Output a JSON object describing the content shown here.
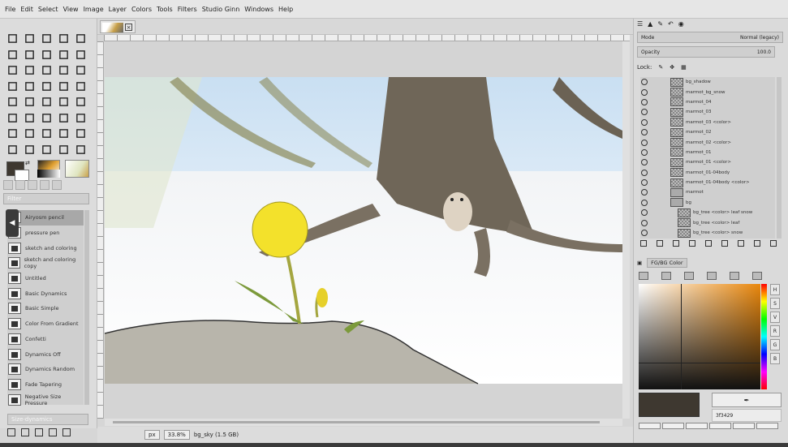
{
  "menu": [
    "File",
    "Edit",
    "Select",
    "View",
    "Image",
    "Layer",
    "Colors",
    "Tools",
    "Filters",
    "Studio Ginn",
    "Windows",
    "Help"
  ],
  "toolbox": {
    "filter_label": "Filter",
    "dynamics": [
      "Airyosm pencil",
      "pressure pen",
      "sketch and coloring",
      "sketch and coloring copy",
      "Untitled",
      "Basic Dynamics",
      "Basic Simple",
      "Color From Gradient",
      "Confetti",
      "Dynamics Off",
      "Dynamics Random",
      "Fade Tapering",
      "Negative Size Pressure"
    ],
    "dynamics_selector": "Size-dynamics",
    "fg_color": "#3e3830",
    "bg_color": "#ffffff"
  },
  "status": {
    "unit": "px",
    "zoom": "33.8%",
    "layer_info": "bg_sky (1.5 GB)"
  },
  "layers_panel": {
    "mode_label": "Mode",
    "mode_value": "Normal (legacy)",
    "opacity_label": "Opacity",
    "opacity_value": "100.0",
    "lock_label": "Lock:",
    "layers": [
      {
        "name": "bg_shadow",
        "type": "layer"
      },
      {
        "name": "marmot_bg_snow",
        "type": "layer"
      },
      {
        "name": "marmot_04",
        "type": "layer"
      },
      {
        "name": "marmot_03",
        "type": "layer"
      },
      {
        "name": "marmot_03 <color>",
        "type": "layer"
      },
      {
        "name": "marmot_02",
        "type": "layer"
      },
      {
        "name": "marmot_02 <color>",
        "type": "layer"
      },
      {
        "name": "marmot_01",
        "type": "layer"
      },
      {
        "name": "marmot_01 <color>",
        "type": "layer"
      },
      {
        "name": "marmot_01-04body",
        "type": "layer"
      },
      {
        "name": "marmot_01-04body <color>",
        "type": "layer"
      },
      {
        "name": "marmot",
        "type": "group"
      },
      {
        "name": "bg",
        "type": "group"
      },
      {
        "name": "bg_tree <color> leaf snow",
        "type": "child"
      },
      {
        "name": "bg_tree <color> leaf",
        "type": "child"
      },
      {
        "name": "bg_tree <color> snow",
        "type": "child"
      }
    ]
  },
  "color_panel": {
    "title": "FG/BG Color",
    "channels": [
      "H",
      "S",
      "V",
      "R",
      "G",
      "B"
    ],
    "hex": "3f3429",
    "current_color": "#3e3830"
  }
}
